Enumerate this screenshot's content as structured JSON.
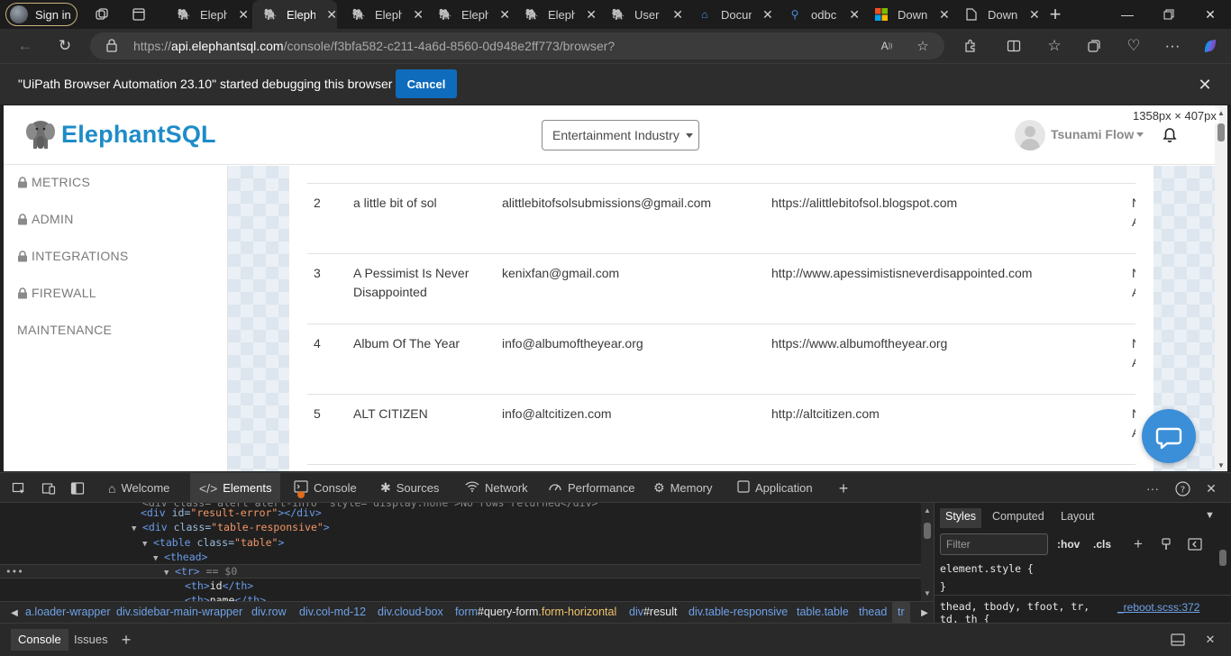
{
  "browser": {
    "signin_label": "Sign in",
    "tabs": [
      {
        "label": "Elephant",
        "icon": "elephant-favicon",
        "active": false
      },
      {
        "label": "Elephant",
        "icon": "elephant-favicon",
        "active": true
      },
      {
        "label": "Elephant",
        "icon": "elephant-favicon",
        "active": false
      },
      {
        "label": "Elephant",
        "icon": "elephant-favicon",
        "active": false
      },
      {
        "label": "Elephant",
        "icon": "elephant-favicon",
        "active": false
      },
      {
        "label": "User s",
        "icon": "elephant-favicon",
        "active": false
      },
      {
        "label": "Docum",
        "icon": "docs-favicon",
        "active": false
      },
      {
        "label": "odbc",
        "icon": "search-favicon",
        "active": false
      },
      {
        "label": "Down",
        "icon": "microsoft-favicon",
        "active": false
      },
      {
        "label": "Down",
        "icon": "document-favicon",
        "active": false
      }
    ],
    "url_prefix": "https://",
    "url_host": "api.elephantsql.com",
    "url_path": "/console/f3bfa582-c211-4a6d-8560-0d948e2ff773/browser?"
  },
  "infobar": {
    "message": "\"UiPath Browser Automation 23.10\" started debugging this browser",
    "cancel_label": "Cancel"
  },
  "viewport_size_label": "1358px × 407px",
  "app": {
    "brand": "ElephantSQL",
    "team_select": "Entertainment Industry",
    "user_name": "Tsunami Flow",
    "sidebar": [
      {
        "label": "METRICS",
        "locked": true
      },
      {
        "label": "ADMIN",
        "locked": true
      },
      {
        "label": "INTEGRATIONS",
        "locked": true
      },
      {
        "label": "FIREWALL",
        "locked": true
      },
      {
        "label": "MAINTENANCE",
        "locked": false
      }
    ],
    "rows": [
      {
        "id": "2",
        "name": "a little bit of sol",
        "email": "alittlebitofsolsubmissions@gmail.com",
        "url": "https://alittlebitofsol.blogspot.com",
        "extra": "N A"
      },
      {
        "id": "3",
        "name": "A Pessimist Is Never Disappointed",
        "email": "kenixfan@gmail.com",
        "url": "http://www.apessimistisneverdisappointed.com",
        "extra": "N A"
      },
      {
        "id": "4",
        "name": "Album Of The Year",
        "email": "info@albumoftheyear.org",
        "url": "https://www.albumoftheyear.org",
        "extra": "N A"
      },
      {
        "id": "5",
        "name": "ALT CITIZEN",
        "email": "info@altcitizen.com",
        "url": "http://altcitizen.com",
        "extra": "N A"
      }
    ]
  },
  "devtools": {
    "tabs": [
      {
        "label": "Welcome",
        "icon": "home-icon"
      },
      {
        "label": "Elements",
        "icon": "code-icon"
      },
      {
        "label": "Console",
        "icon": "console-icon"
      },
      {
        "label": "Sources",
        "icon": "bug-icon"
      },
      {
        "label": "Network",
        "icon": "wifi-icon"
      },
      {
        "label": "Performance",
        "icon": "performance-icon"
      },
      {
        "label": "Memory",
        "icon": "memory-icon"
      },
      {
        "label": "Application",
        "icon": "application-icon"
      }
    ],
    "code": {
      "line0": "<div class=\"alert alert-info\" style=\"display:none\">No rows returned</div>",
      "line1_tag": "<div",
      "line1_attr": " id=",
      "line1_val": "\"result-error\"",
      "line1_end": "></div>",
      "line2_tag": "<div",
      "line2_attr": " class=",
      "line2_val": "\"table-responsive\"",
      "line2_end": ">",
      "line3_tag": "<table",
      "line3_attr": " class=",
      "line3_val": "\"table\"",
      "line3_end": ">",
      "line4": "<thead>",
      "line5": "<tr>",
      "line5_marker": " == $0",
      "line6_open": "<th>",
      "line6_text": "id",
      "line6_close": "</th>",
      "line7_open": "<th>",
      "line7_text": "name",
      "line7_close": "</th>"
    },
    "breadcrumbs": [
      {
        "tag": "div",
        "sep": ".",
        "name": "loader-wrapper",
        "kind": "cls-plain",
        "shown": ".loader-wrapper"
      },
      {
        "shown": "div.sidebar-main-wrapper"
      },
      {
        "shown": "div.row"
      },
      {
        "shown": "div.col-md-12"
      },
      {
        "shown": "div.cloud-box"
      },
      {
        "shown": "form#query-form.form-horizontal"
      },
      {
        "shown": "div#result"
      },
      {
        "shown": "div.table-responsive"
      },
      {
        "shown": "table.table"
      },
      {
        "shown": "thead"
      },
      {
        "shown": "tr"
      }
    ],
    "breadcrumb_form": {
      "tag": "form",
      "id": "#query-form",
      "cls": ".form-horizontal"
    },
    "breadcrumb_result": {
      "tag": "div",
      "id": "#result"
    },
    "styles": {
      "tabs": [
        "Styles",
        "Computed",
        "Layout"
      ],
      "filter_placeholder": "Filter",
      "hov": ":hov",
      "cls": ".cls",
      "rule1_open": "element.style {",
      "rule1_close": "}",
      "rule2": "thead, tbody, tfoot, tr,",
      "rule2b": "td, th {",
      "rule2_source": "_reboot.scss:372"
    },
    "drawer": {
      "console": "Console",
      "issues": "Issues"
    }
  }
}
